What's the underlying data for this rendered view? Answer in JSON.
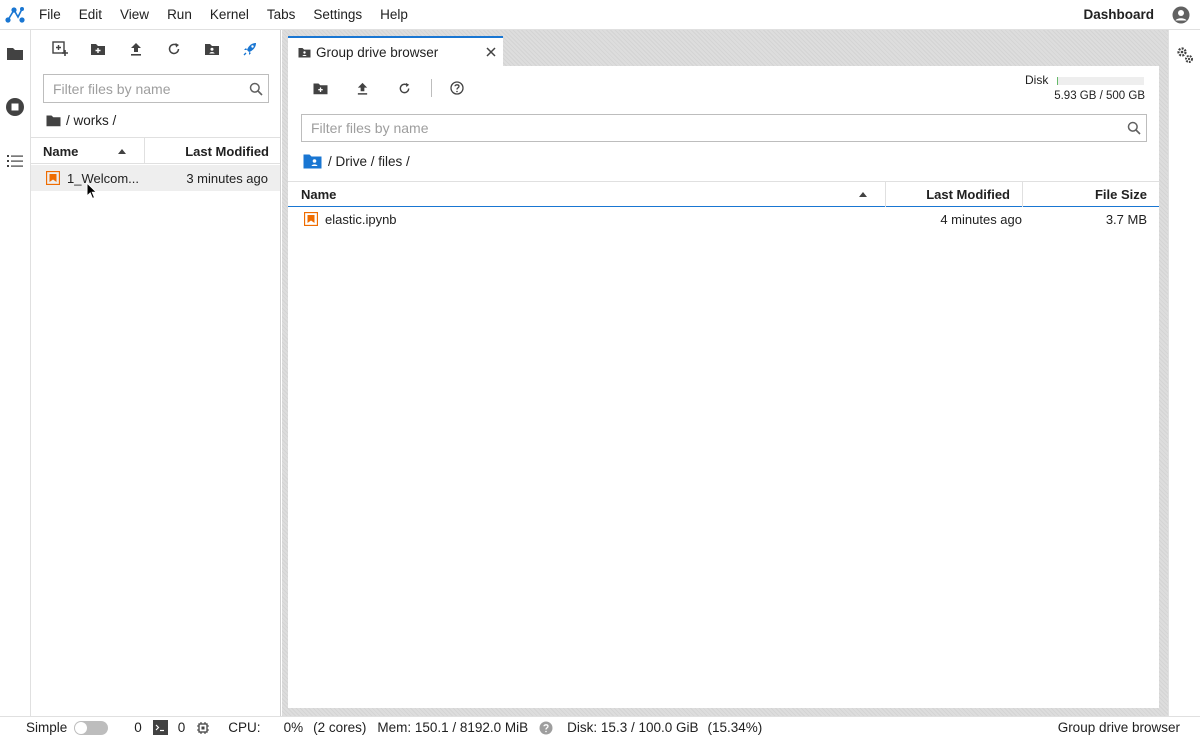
{
  "menubar": {
    "items": [
      "File",
      "Edit",
      "View",
      "Run",
      "Kernel",
      "Tabs",
      "Settings",
      "Help"
    ],
    "dashboard_label": "Dashboard"
  },
  "left_browser": {
    "filter_placeholder": "Filter files by name",
    "breadcrumb": "/ works /",
    "columns": {
      "name": "Name",
      "modified": "Last Modified"
    },
    "files": [
      {
        "name": "1_Welcom...",
        "modified": "3 minutes ago",
        "icon": "notebook-icon"
      }
    ]
  },
  "main": {
    "tab_title": "Group drive browser",
    "disk": {
      "label": "Disk",
      "usage_text": "5.93 GB / 500 GB",
      "fraction": 0.012
    },
    "filter_placeholder": "Filter files by name",
    "breadcrumb": "/ Drive / files /",
    "columns": {
      "name": "Name",
      "modified": "Last Modified",
      "size": "File Size"
    },
    "files": [
      {
        "name": "elastic.ipynb",
        "modified": "4 minutes ago",
        "size": "3.7 MB",
        "icon": "notebook-icon"
      }
    ]
  },
  "statusbar": {
    "mode_label": "Simple",
    "kernels_count": "0",
    "terminals_count": "0",
    "cpu_label": "CPU:",
    "cpu_value": "0%",
    "cpu_cores": "(2 cores)",
    "mem_text": "Mem: 150.1 / 8192.0 MiB",
    "disk_text": "Disk: 15.3 / 100.0 GiB",
    "disk_percent": "(15.34%)",
    "right_label": "Group drive browser"
  },
  "colors": {
    "accent": "#1976d2",
    "notebook_orange": "#ef6c00",
    "disk_fill": "#66bb6a"
  }
}
